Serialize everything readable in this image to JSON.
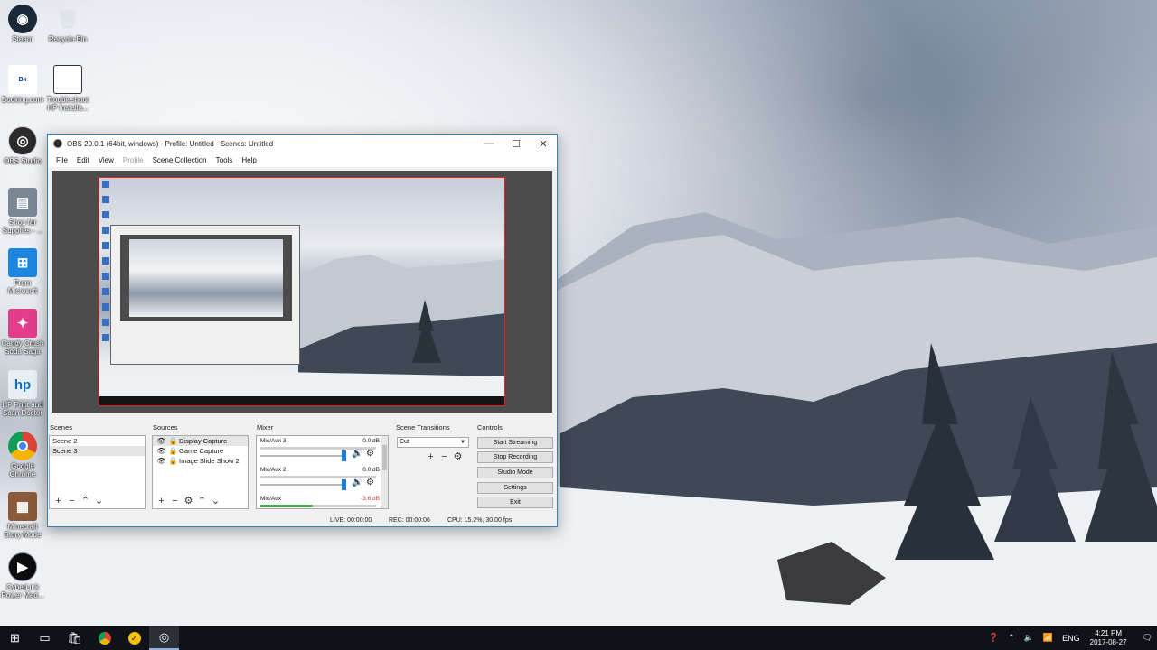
{
  "desktop_icons": [
    {
      "label": "Steam",
      "icon": "steam-icon",
      "color": "#1b2838"
    },
    {
      "label": "Recycle Bin",
      "icon": "recycle-bin-icon",
      "color": "#9aa3ad"
    },
    {
      "label": "Booking.com",
      "icon": "booking-icon",
      "color": "#003580"
    },
    {
      "label": "Troubleshoot HP Installa...",
      "icon": "window-icon",
      "color": "#ffffff"
    },
    {
      "label": "OBS Studio",
      "icon": "obs-icon",
      "color": "#2b2b2b"
    },
    {
      "label": "Shop for Supplies - ...",
      "icon": "printer-icon",
      "color": "#7b8794"
    },
    {
      "label": "From Microsoft",
      "icon": "windows-icon",
      "color": "#1c86e0"
    },
    {
      "label": "Candy Crush Soda Saga",
      "icon": "candy-crush-icon",
      "color": "#e23c8b"
    },
    {
      "label": "HP Print and Scan Doctor",
      "icon": "hp-icon",
      "color": "#0a71c6"
    },
    {
      "label": "Google Chrome",
      "icon": "chrome-icon",
      "color": "#db4437"
    },
    {
      "label": "Minecraft Story Mode",
      "icon": "minecraft-icon",
      "color": "#8a5a3a"
    },
    {
      "label": "CyberLink Power Med...",
      "icon": "cyberlink-icon",
      "color": "#0d0d0d"
    }
  ],
  "obs": {
    "title": "OBS 20.0.1 (64bit, windows) - Profile: Untitled - Scenes: Untitled",
    "menu": [
      "File",
      "Edit",
      "View",
      "Profile",
      "Scene Collection",
      "Tools",
      "Help"
    ],
    "docks": {
      "scenes": "Scenes",
      "sources": "Sources",
      "mixer": "Mixer",
      "transitions": "Scene Transitions",
      "controls": "Controls"
    },
    "scenes": [
      "Scene 2",
      "Scene 3"
    ],
    "sources": [
      "Display Capture",
      "Game Capture",
      "Image Slide Show 2"
    ],
    "mixer": [
      {
        "name": "Mic/Aux 3",
        "db": "0.0 dB",
        "level": 0.0
      },
      {
        "name": "Mic/Aux 2",
        "db": "0.0 dB",
        "level": 0.0
      },
      {
        "name": "Mic/Aux",
        "db": "-3.6 dB",
        "level": 0.45
      }
    ],
    "transition": "Cut",
    "controls": [
      "Start Streaming",
      "Stop Recording",
      "Studio Mode",
      "Settings",
      "Exit"
    ],
    "status": {
      "live": "LIVE: 00:00:00",
      "rec": "REC: 00:00:06",
      "cpu": "CPU: 15.2%, 30.00 fps"
    }
  },
  "taskbar": {
    "language": "ENG",
    "time": "4:21 PM",
    "date": "2017-08-27"
  }
}
